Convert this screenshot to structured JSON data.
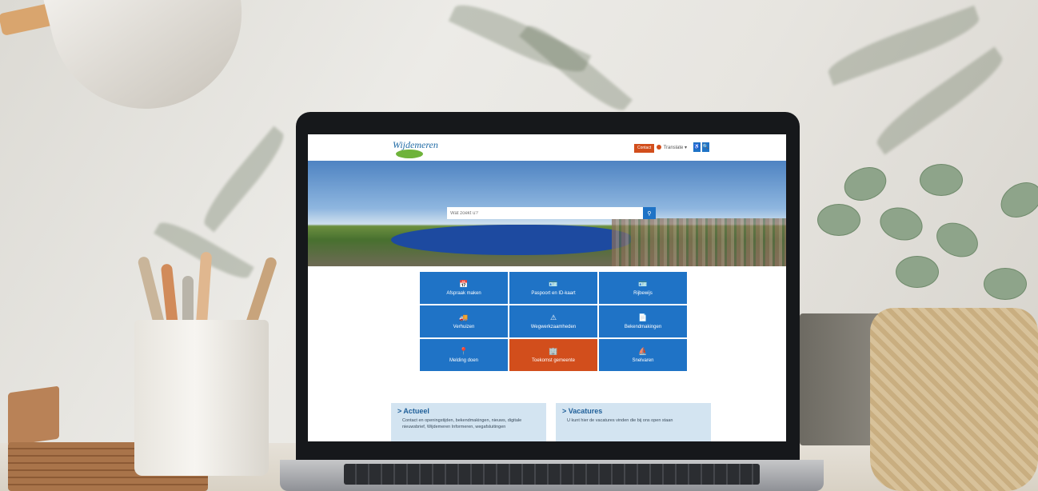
{
  "site": {
    "logo_text": "Wijdemeren",
    "header": {
      "contact_label": "Contact",
      "translate_label": "Translate",
      "translate_caret": "▾",
      "btn1_label": "♿",
      "btn2_label": "🔍"
    },
    "search": {
      "placeholder": "Wat zoekt u?",
      "button_icon": "search-icon"
    },
    "tiles": [
      {
        "label": "Afspraak maken",
        "icon": "calendar-icon",
        "symbol": "📅"
      },
      {
        "label": "Paspoort en ID-kaart",
        "icon": "id-card-icon",
        "symbol": "🪪"
      },
      {
        "label": "Rijbewijs",
        "icon": "license-icon",
        "symbol": "🪪"
      },
      {
        "label": "Verhuizen",
        "icon": "truck-icon",
        "symbol": "🚚"
      },
      {
        "label": "Wegwerkzaamheden",
        "icon": "road-warning-icon",
        "symbol": "⚠"
      },
      {
        "label": "Bekendmakingen",
        "icon": "document-icon",
        "symbol": "📄"
      },
      {
        "label": "Melding doen",
        "icon": "report-icon",
        "symbol": "📍"
      },
      {
        "label": "Toekomst gemeente",
        "icon": "building-icon",
        "symbol": "🏢"
      },
      {
        "label": "Snelvaren",
        "icon": "boat-icon",
        "symbol": "⛵"
      }
    ],
    "cards": [
      {
        "title": "> Actueel",
        "text": "Contact en openingstijden, bekendmakingen, nieuws, digitale nieuwsbrief, Wijdemeren Informeren, wegafsluitingen"
      },
      {
        "title": "> Vacatures",
        "text": "U kunt hier de vacatures vinden die bij ons open staan"
      }
    ],
    "colors": {
      "primary_blue": "#1f73c6",
      "accent_orange": "#d24e1c",
      "card_bg": "#d3e4f1"
    }
  }
}
